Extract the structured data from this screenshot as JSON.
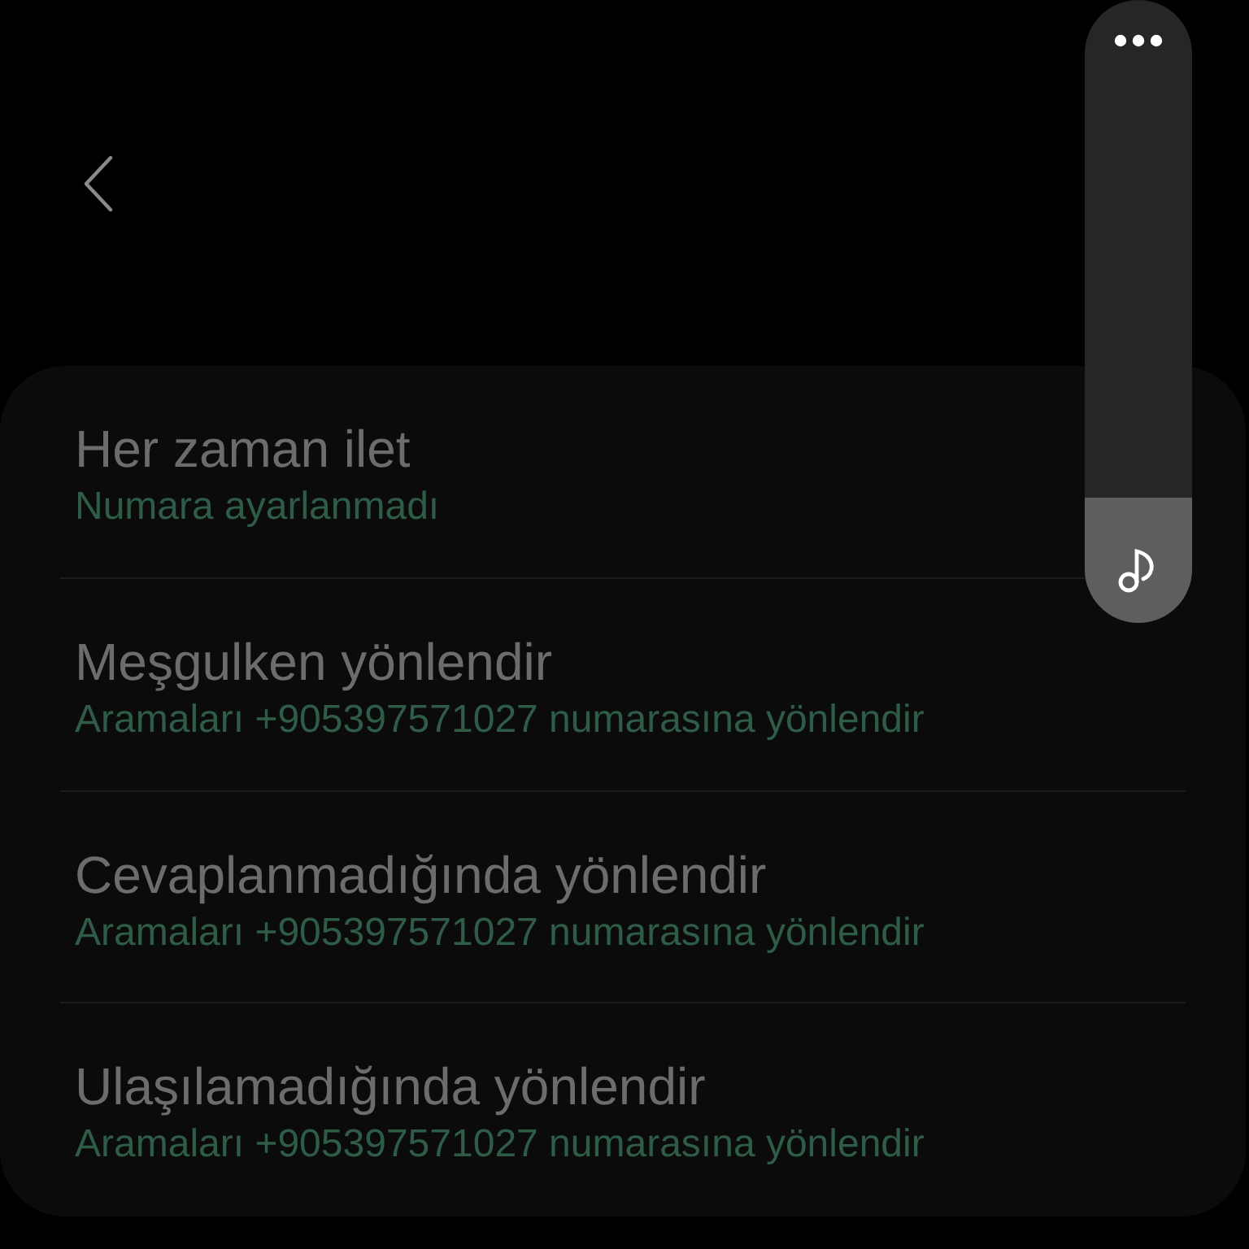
{
  "settings": [
    {
      "title": "Her zaman ilet",
      "subtitle": "Numara ayarlanmadı"
    },
    {
      "title": "Meşgulken yönlendir",
      "subtitle": "Aramaları +905397571027 numarasına yönlendir"
    },
    {
      "title": "Cevaplanmadığında yönlendir",
      "subtitle": "Aramaları +905397571027 numarasına yönlendir"
    },
    {
      "title": "Ulaşılamadığında yönlendir",
      "subtitle": "Aramaları +905397571027 numarasına yönlendir"
    }
  ],
  "volume": {
    "level": 0.23
  }
}
